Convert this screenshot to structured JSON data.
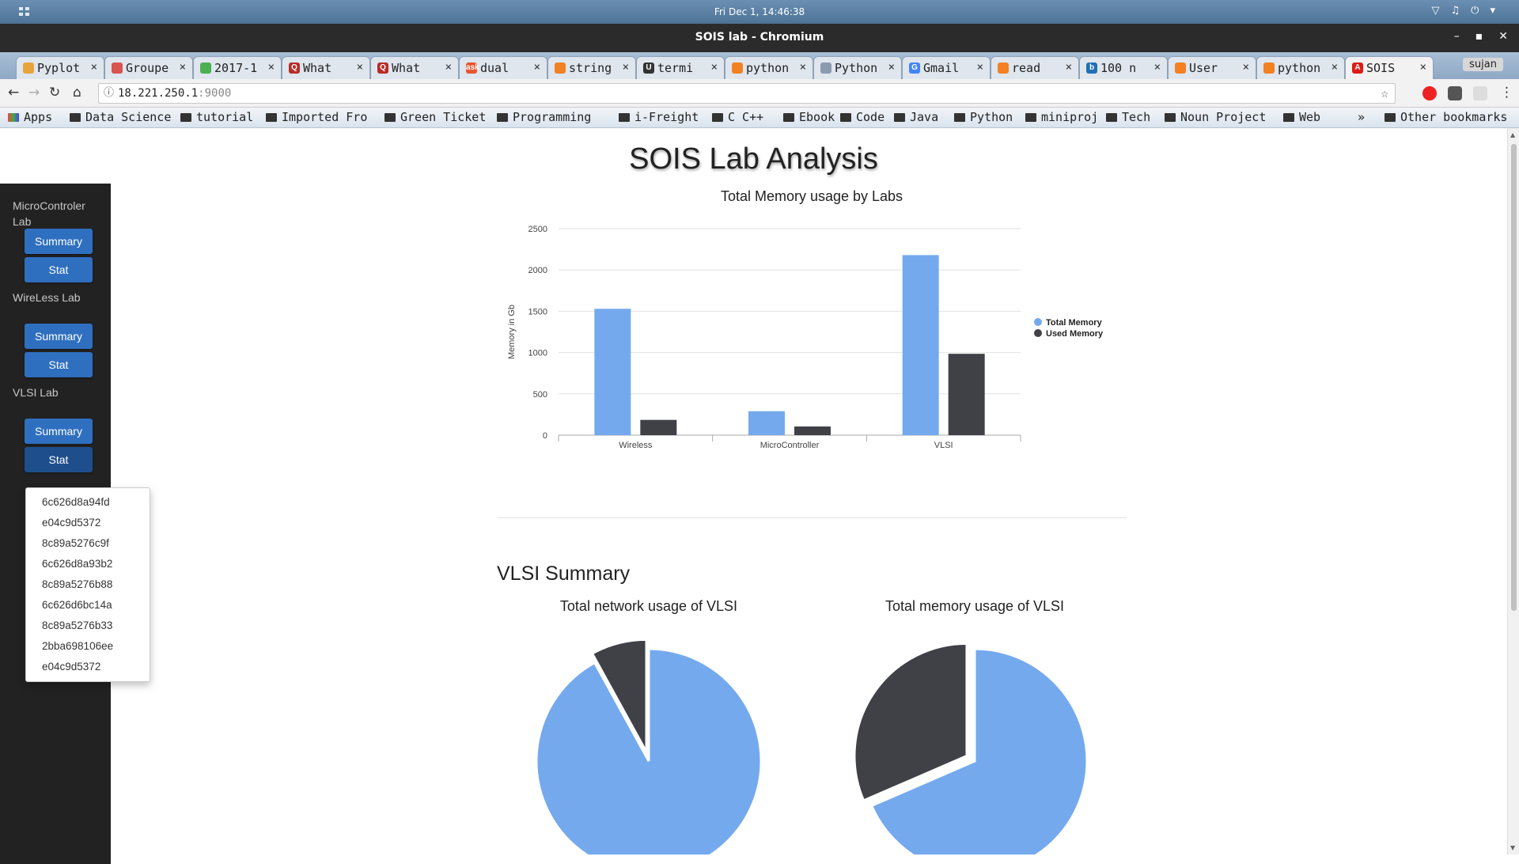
{
  "os": {
    "clock": "Fri Dec  1, 14:46:38"
  },
  "window": {
    "title": "SOIS lab - Chromium"
  },
  "tabs": [
    {
      "label": "Pyplot",
      "fav_color": "#e8a33d",
      "fav": ""
    },
    {
      "label": "Groupe",
      "fav_color": "#d9534f",
      "fav": ""
    },
    {
      "label": "2017-1",
      "fav_color": "#4caf50",
      "fav": ""
    },
    {
      "label": "What",
      "fav_color": "#b92b27",
      "fav": "Q"
    },
    {
      "label": "What",
      "fav_color": "#b92b27",
      "fav": "Q"
    },
    {
      "label": "dual",
      "fav_color": "#e8552e",
      "fav": "ask"
    },
    {
      "label": "string",
      "fav_color": "#f48024",
      "fav": ""
    },
    {
      "label": "termi",
      "fav_color": "#333333",
      "fav": "U"
    },
    {
      "label": "python",
      "fav_color": "#f48024",
      "fav": ""
    },
    {
      "label": "Python",
      "fav_color": "#8a9bb0",
      "fav": ""
    },
    {
      "label": "Gmail",
      "fav_color": "#4285f4",
      "fav": "G"
    },
    {
      "label": "read",
      "fav_color": "#f48024",
      "fav": ""
    },
    {
      "label": "100 n",
      "fav_color": "#1f6fb2",
      "fav": "b"
    },
    {
      "label": "User",
      "fav_color": "#f48024",
      "fav": ""
    },
    {
      "label": "python",
      "fav_color": "#f48024",
      "fav": ""
    },
    {
      "label": "SOIS",
      "fav_color": "#dd1b16",
      "fav": "A"
    }
  ],
  "profile": {
    "name": "sujan"
  },
  "address": {
    "host": "18.221.250.1",
    "port": ":9000"
  },
  "bookmarks": [
    {
      "label": "Apps"
    },
    {
      "label": "Data Science"
    },
    {
      "label": "tutorial"
    },
    {
      "label": "Imported Fro"
    },
    {
      "label": "Green Ticket"
    },
    {
      "label": "Programming"
    },
    {
      "label": "i-Freight"
    },
    {
      "label": "C C++"
    },
    {
      "label": "Ebook"
    },
    {
      "label": "Code"
    },
    {
      "label": "Java"
    },
    {
      "label": "Python"
    },
    {
      "label": "miniproj"
    },
    {
      "label": "Tech"
    },
    {
      "label": "Noun Project"
    },
    {
      "label": "Web"
    },
    {
      "label": "»"
    },
    {
      "label": "Other bookmarks"
    }
  ],
  "page": {
    "title": "SOIS Lab Analysis"
  },
  "sidebar": {
    "labs": [
      {
        "name": "MicroControler Lab",
        "summary": "Summary",
        "stat": "Stat"
      },
      {
        "name": "WireLess Lab",
        "summary": "Summary",
        "stat": "Stat"
      },
      {
        "name": "VLSI Lab",
        "summary": "Summary",
        "stat": "Stat"
      }
    ],
    "dropdown": [
      "6c626d8a94fd",
      "e04c9d5372",
      "8c89a5276c9f",
      "6c626d8a93b2",
      "8c89a5276b88",
      "6c626d6bc14a",
      "8c89a5276b33",
      "2bba698106ee",
      "e04c9d5372"
    ]
  },
  "section": {
    "title": "VLSI Summary"
  },
  "colors": {
    "total": "#74a9ee",
    "used": "#404047",
    "button": "#2f6fbf"
  },
  "chart_data": [
    {
      "type": "bar",
      "title": "Total Memory usage by Labs",
      "ylabel": "Memory in Gb",
      "xlabel": "",
      "categories": [
        "Wireless",
        "MicroController",
        "VLSI"
      ],
      "series": [
        {
          "name": "Total Memory",
          "values": [
            1530,
            290,
            2180
          ]
        },
        {
          "name": "Used Memory",
          "values": [
            185,
            105,
            985
          ]
        }
      ],
      "ylim": [
        0,
        2500
      ],
      "yticks": [
        0,
        500,
        1000,
        1500,
        2000,
        2500
      ],
      "grid": true,
      "legend": "right"
    },
    {
      "type": "pie",
      "title": "Total network usage of VLSI",
      "slices": [
        {
          "value": 92
        },
        {
          "value": 8
        }
      ],
      "exploded": 1
    },
    {
      "type": "pie",
      "title": "Total memory usage of VLSI",
      "slices": [
        {
          "value": 68.5
        },
        {
          "value": 31.5
        }
      ],
      "exploded": 1
    }
  ]
}
